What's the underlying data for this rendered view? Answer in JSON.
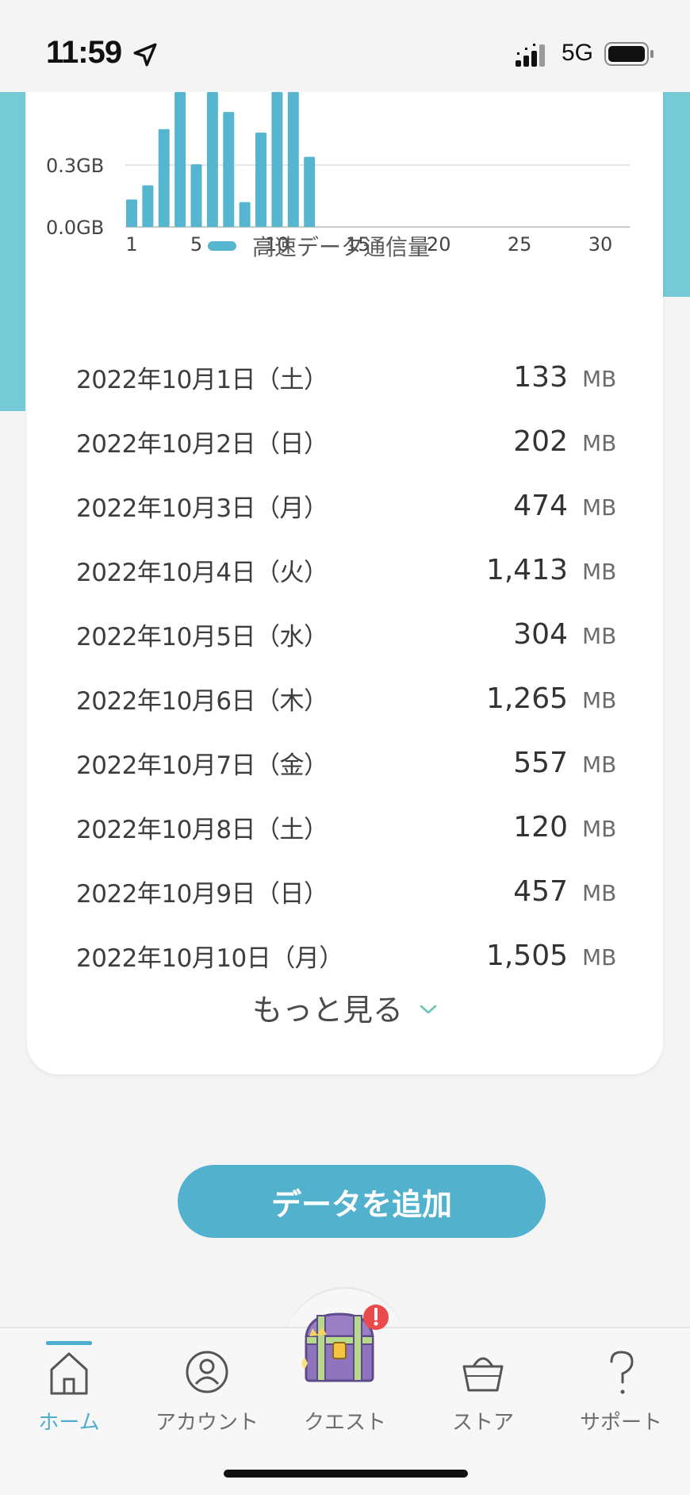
{
  "status_bar": {
    "time": "11:59",
    "network": "5G"
  },
  "chart_data": {
    "type": "bar",
    "ytick_labels": [
      "0.0GB",
      "0.3GB"
    ],
    "yticks": [
      0,
      0.3
    ],
    "xticks": [
      1,
      5,
      10,
      15,
      20,
      25,
      30
    ],
    "xlim": [
      1,
      30
    ],
    "ylim": [
      0,
      0.4
    ],
    "series": [
      {
        "name": "高速データ通信量",
        "color": "#56b6cf",
        "x": [
          1,
          2,
          3,
          4,
          5,
          6,
          7,
          8,
          9,
          10,
          11,
          12
        ],
        "values": [
          0.133,
          0.202,
          0.474,
          1.413,
          0.304,
          1.265,
          0.557,
          0.12,
          0.457,
          1.505,
          0.9,
          0.34
        ]
      }
    ],
    "grid": true
  },
  "legend": {
    "label": "高速データ通信量"
  },
  "usage": [
    {
      "date": "2022年10月1日（土）",
      "value": "133",
      "unit": "MB"
    },
    {
      "date": "2022年10月2日（日）",
      "value": "202",
      "unit": "MB"
    },
    {
      "date": "2022年10月3日（月）",
      "value": "474",
      "unit": "MB"
    },
    {
      "date": "2022年10月4日（火）",
      "value": "1,413",
      "unit": "MB"
    },
    {
      "date": "2022年10月5日（水）",
      "value": "304",
      "unit": "MB"
    },
    {
      "date": "2022年10月6日（木）",
      "value": "1,265",
      "unit": "MB"
    },
    {
      "date": "2022年10月7日（金）",
      "value": "557",
      "unit": "MB"
    },
    {
      "date": "2022年10月8日（土）",
      "value": "120",
      "unit": "MB"
    },
    {
      "date": "2022年10月9日（日）",
      "value": "457",
      "unit": "MB"
    },
    {
      "date": "2022年10月10日（月）",
      "value": "1,505",
      "unit": "MB"
    }
  ],
  "more_label": "もっと見る",
  "add_data_button": "データを追加",
  "tabs": [
    {
      "label": "ホーム",
      "icon": "home-icon",
      "active": true
    },
    {
      "label": "アカウント",
      "icon": "account-icon",
      "active": false
    },
    {
      "label": "クエスト",
      "icon": "treasure-chest-icon",
      "active": false
    },
    {
      "label": "ストア",
      "icon": "basket-icon",
      "active": false
    },
    {
      "label": "サポート",
      "icon": "question-icon",
      "active": false
    }
  ],
  "colors": {
    "accent": "#52b1cd",
    "teal_band": "#76cad6",
    "active_tab": "#4eaed0",
    "badge": "#e94b4b"
  }
}
